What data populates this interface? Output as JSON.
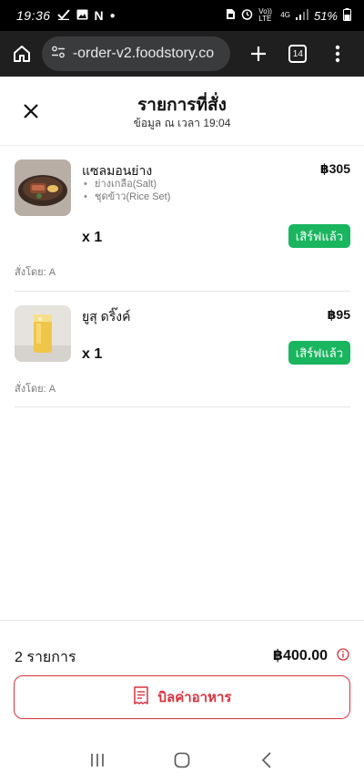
{
  "status_bar": {
    "time": "19:36",
    "network": "4G",
    "network_label": "Vo)) LTE",
    "battery": "51%"
  },
  "browser": {
    "url": "-order-v2.foodstory.co",
    "tab_count": "14"
  },
  "header": {
    "title": "รายการที่สั่ง",
    "subtitle": "ข้อมูล ณ เวลา 19:04"
  },
  "items": [
    {
      "name": "แซลมอนย่าง",
      "price": "฿305",
      "options": [
        "ย่างเกลือ(Salt)",
        "ชุดข้าว(Rice Set)"
      ],
      "quantity": "x 1",
      "status": "เสิร์ฟแล้ว",
      "ordered_by": "สั่งโดย: A"
    },
    {
      "name": "ยูสุ ดริ๊งค์",
      "price": "฿95",
      "options": [],
      "quantity": "x 1",
      "status": "เสิร์ฟแล้ว",
      "ordered_by": "สั่งโดย: A"
    }
  ],
  "summary": {
    "item_count": "2 รายการ",
    "total": "฿400.00",
    "bill_button": "บิลค่าอาหาร"
  },
  "colors": {
    "served_green": "#19b55f",
    "accent_red": "#d9323c"
  }
}
